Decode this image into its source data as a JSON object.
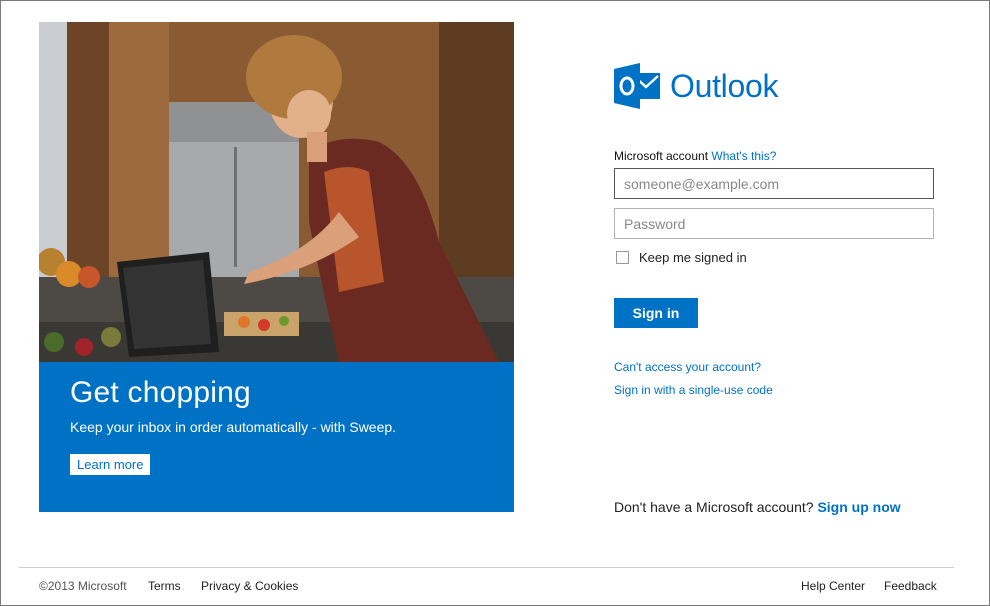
{
  "hero": {
    "title": "Get chopping",
    "subtitle": "Keep your inbox in order automatically - with Sweep.",
    "cta": "Learn more",
    "banner_color": "#0072c6"
  },
  "logo": {
    "text": "Outlook",
    "icon": "outlook-logo-icon",
    "color": "#0072c6"
  },
  "login": {
    "account_label": "Microsoft account",
    "account_help_link": "What's this?",
    "email_placeholder": "someone@example.com",
    "password_placeholder": "Password",
    "keep_signed_in": "Keep me signed in",
    "signin_button": "Sign in",
    "cant_access": "Can't access your account?",
    "single_use_code": "Sign in with a single-use code",
    "no_account": "Don't have a Microsoft account?",
    "signup": "Sign up now"
  },
  "footer": {
    "copyright": "©2013 Microsoft",
    "terms": "Terms",
    "privacy": "Privacy & Cookies",
    "help": "Help Center",
    "feedback": "Feedback"
  }
}
